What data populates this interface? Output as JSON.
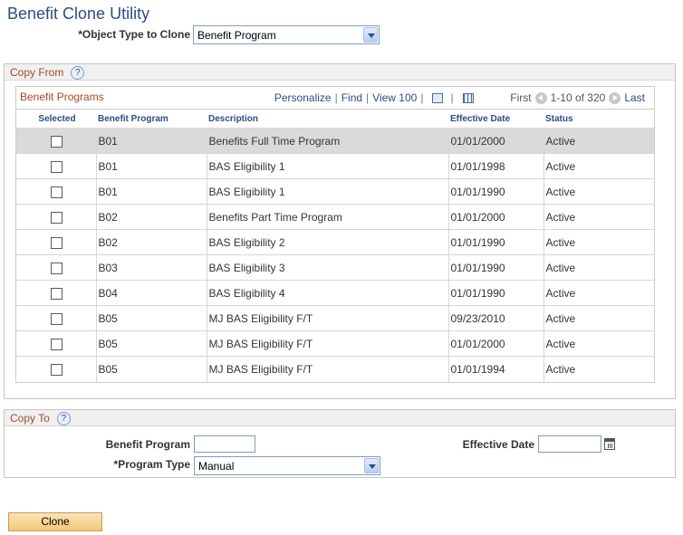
{
  "page": {
    "title": "Benefit Clone Utility"
  },
  "object_type": {
    "label": "*Object Type to Clone",
    "value": "Benefit Program"
  },
  "copy_from": {
    "header": "Copy From",
    "grid": {
      "title": "Benefit Programs",
      "personalize": "Personalize",
      "find": "Find",
      "view": "View 100",
      "first": "First",
      "range": "1-10 of 320",
      "last": "Last",
      "columns": [
        "Selected",
        "Benefit Program",
        "Description",
        "Effective Date",
        "Status"
      ],
      "rows": [
        {
          "program": "B01",
          "description": "Benefits Full Time Program",
          "date": "01/01/2000",
          "status": "Active"
        },
        {
          "program": "B01",
          "description": "BAS Eligibility 1",
          "date": "01/01/1998",
          "status": "Active"
        },
        {
          "program": "B01",
          "description": "BAS Eligibility 1",
          "date": "01/01/1990",
          "status": "Active"
        },
        {
          "program": "B02",
          "description": "Benefits Part Time Program",
          "date": "01/01/2000",
          "status": "Active"
        },
        {
          "program": "B02",
          "description": "BAS Eligibility 2",
          "date": "01/01/1990",
          "status": "Active"
        },
        {
          "program": "B03",
          "description": "BAS Eligibility 3",
          "date": "01/01/1990",
          "status": "Active"
        },
        {
          "program": "B04",
          "description": "BAS Eligibility 4",
          "date": "01/01/1990",
          "status": "Active"
        },
        {
          "program": "B05",
          "description": "MJ BAS Eligibility F/T",
          "date": "09/23/2010",
          "status": "Active"
        },
        {
          "program": "B05",
          "description": "MJ BAS Eligibility F/T",
          "date": "01/01/2000",
          "status": "Active"
        },
        {
          "program": "B05",
          "description": "MJ BAS Eligibility F/T",
          "date": "01/01/1994",
          "status": "Active"
        }
      ]
    }
  },
  "copy_to": {
    "header": "Copy To",
    "benefit_program_label": "Benefit Program",
    "benefit_program_value": "",
    "effective_date_label": "Effective Date",
    "effective_date_value": "",
    "program_type_label": "*Program Type",
    "program_type_value": "Manual"
  },
  "actions": {
    "clone_label": "Clone"
  },
  "icons": {
    "help": "help-icon",
    "calendar": "calendar-icon",
    "dropdown": "chevron-down-icon"
  },
  "colors": {
    "title": "#2b4d85",
    "section_header": "#a24a26",
    "highlight_row": "#dadada",
    "button": "#f3c77a"
  }
}
